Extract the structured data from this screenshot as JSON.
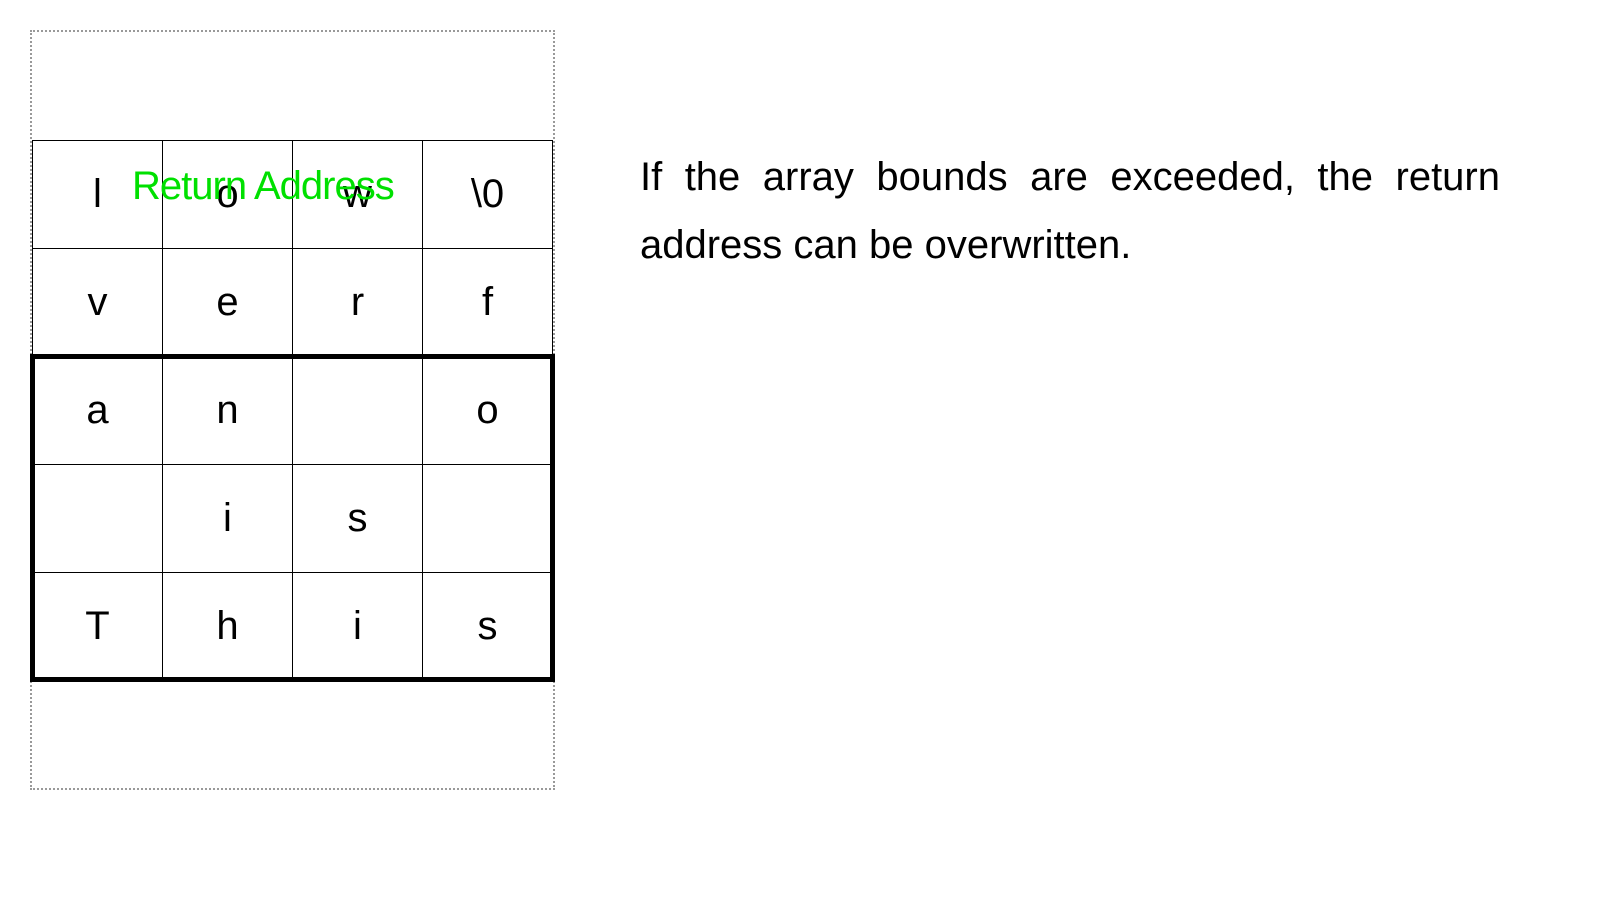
{
  "grid": {
    "rows": [
      [
        "l",
        "o",
        "w",
        "\\0"
      ],
      [
        "v",
        "e",
        "r",
        "f"
      ],
      [
        "a",
        "n",
        "",
        "o"
      ],
      [
        "",
        "i",
        "s",
        ""
      ],
      [
        "T",
        "h",
        "i",
        "s"
      ]
    ]
  },
  "overlay_label": "Return Address",
  "explanation": "If the array bounds are exceeded, the return address can be overwritten."
}
